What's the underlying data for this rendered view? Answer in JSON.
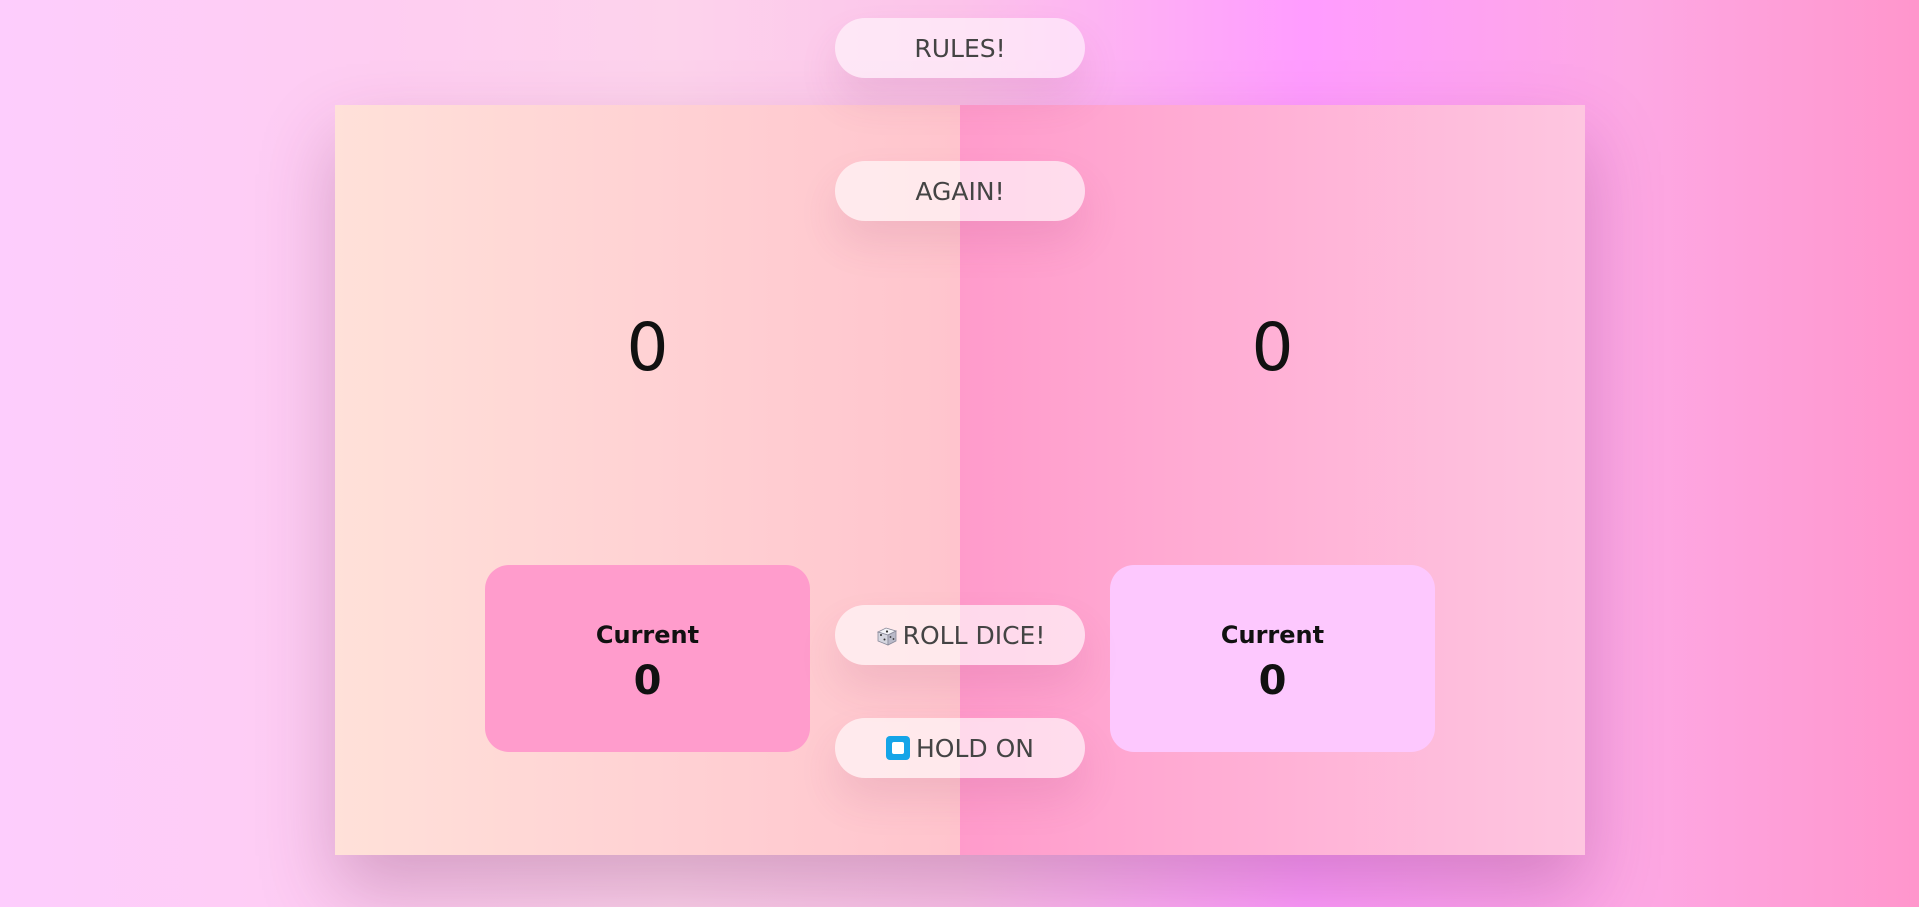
{
  "buttons": {
    "rules": "RULES!",
    "again": "AGAIN!",
    "roll": "ROLL DICE!",
    "hold": "HOLD ON"
  },
  "players": [
    {
      "score": "0",
      "current_label": "Current",
      "current_value": "0"
    },
    {
      "score": "0",
      "current_label": "Current",
      "current_value": "0"
    }
  ],
  "icons": {
    "roll": "dice-icon",
    "hold": "stop-button-icon"
  },
  "colors": {
    "player1_current_box": "#ff9ccc",
    "player2_current_box": "#fdc8fe",
    "hold_icon": "#14a5e8"
  }
}
